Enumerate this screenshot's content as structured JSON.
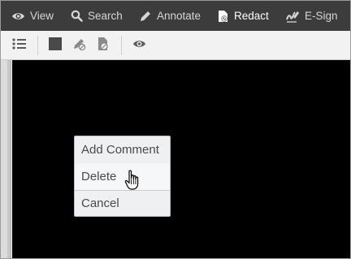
{
  "toolbar": {
    "view_label": "View",
    "search_label": "Search",
    "annotate_label": "Annotate",
    "redact_label": "Redact",
    "esign_label": "E-Sign",
    "active_tab": "Redact"
  },
  "subtoolbar": {
    "icons": [
      "list-icon",
      "redact-box-icon",
      "redact-pen-icon",
      "redact-file-icon",
      "eye-icon"
    ]
  },
  "context_menu": {
    "items": [
      {
        "label": "Add Comment"
      },
      {
        "label": "Delete"
      },
      {
        "label": "Cancel"
      }
    ]
  },
  "colors": {
    "topbar_bg": "#3c3c3c",
    "subbar_bg": "#f2f2f2",
    "document_bg": "#000000",
    "menu_bg": "#eef0f2"
  }
}
